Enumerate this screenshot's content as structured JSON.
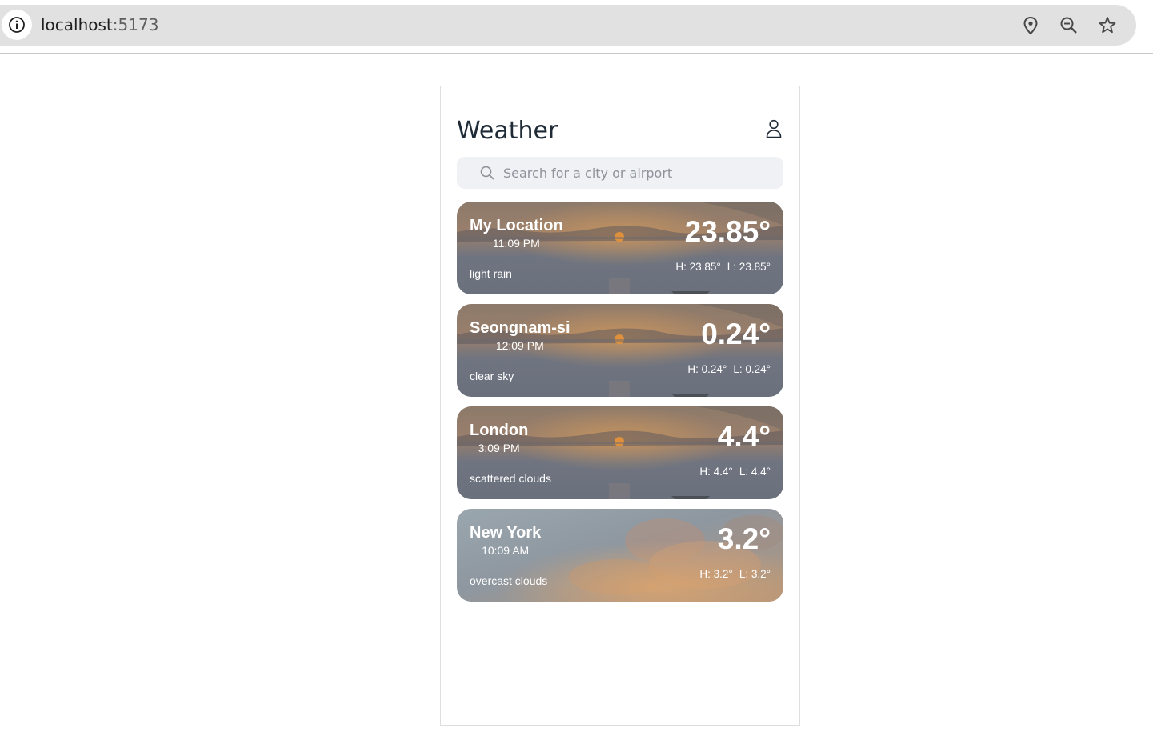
{
  "browser": {
    "url_host": "localhost",
    "url_port": ":5173",
    "icons": [
      "info-icon",
      "location-pin-icon",
      "zoom-out-icon",
      "bookmark-star-icon"
    ]
  },
  "app": {
    "title": "Weather",
    "profile_icon": "user-icon",
    "search": {
      "placeholder": "Search for a city or airport",
      "value": ""
    }
  },
  "cards": [
    {
      "city": "My Location",
      "time": "11:09 PM",
      "description": "light rain",
      "temp": "23.85°",
      "high": "H: 23.85°",
      "low": "L: 23.85°",
      "background": "sunset-lake"
    },
    {
      "city": "Seongnam-si",
      "time": "12:09 PM",
      "description": "clear sky",
      "temp": "0.24°",
      "high": "H: 0.24°",
      "low": "L: 0.24°",
      "background": "sunset-lake"
    },
    {
      "city": "London",
      "time": "3:09 PM",
      "description": "scattered clouds",
      "temp": "4.4°",
      "high": "H: 4.4°",
      "low": "L: 4.4°",
      "background": "sunset-lake"
    },
    {
      "city": "New York",
      "time": "10:09 AM",
      "description": "overcast clouds",
      "temp": "3.2°",
      "high": "H: 3.2°",
      "low": "L: 3.2°",
      "background": "cloudy-sky"
    }
  ],
  "colors": {
    "browser_bar": "#e1e1e1",
    "title": "#1e2a36",
    "search_bg": "#f0f1f4",
    "card_overlay": "#6b7280"
  }
}
